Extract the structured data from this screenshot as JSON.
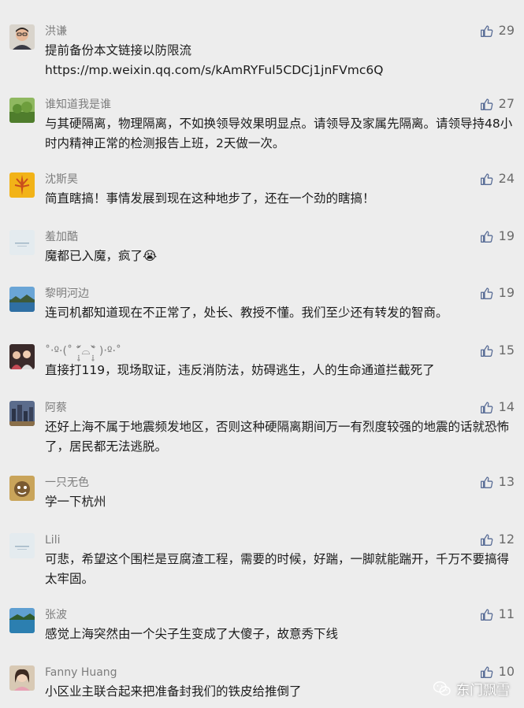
{
  "comments": [
    {
      "name": "洪谦",
      "lines": [
        "提前备份本文链接以防限流",
        "https://mp.weixin.qq.com/s/kAmRYFul5CDCj1jnFVmc6Q"
      ],
      "likes": "29",
      "avatar": "avatar-man-glasses"
    },
    {
      "name": "谁知道我是谁",
      "lines": [
        "与其硬隔离，物理隔离，不如换领导效果明显点。请领导及家属先隔离。请领导持48小时内精神正常的检测报告上班，2天做一次。"
      ],
      "likes": "27",
      "avatar": "avatar-green-field"
    },
    {
      "name": "沈斯昊",
      "lines": [
        "简直瞎搞！事情发展到现在这种地步了，还在一个劲的瞎搞！"
      ],
      "likes": "24",
      "avatar": "avatar-yellow-wheat"
    },
    {
      "name": "羞加酷",
      "lines": [
        "魔都已入魔，疯了😭"
      ],
      "likes": "19",
      "avatar": "avatar-light-text"
    },
    {
      "name": "黎明河边",
      "lines": [
        "连司机都知道现在不正常了，处长、教授不懂。我们至少还有转发的智商。"
      ],
      "likes": "19",
      "avatar": "avatar-blue-landscape"
    },
    {
      "name": "˚‧º·(˚ ˃̣̣̥᷄⌓˂̣̣̥᷅ )‧º·˚",
      "lines": [
        "直接打119，现场取证，违反消防法，妨碍逃生，人的生命通道拦截死了"
      ],
      "likes": "15",
      "avatar": "avatar-people"
    },
    {
      "name": "阿蔡",
      "lines": [
        "还好上海不属于地震频发地区，否则这种硬隔离期间万一有烈度较强的地震的话就恐怖了，居民都无法逃脱。"
      ],
      "likes": "14",
      "avatar": "avatar-city-night"
    },
    {
      "name": "一只无色",
      "lines": [
        "学一下杭州"
      ],
      "likes": "13",
      "avatar": "avatar-cartoon"
    },
    {
      "name": "Lili",
      "lines": [
        "可悲，希望这个围栏是豆腐渣工程，需要的时候，好踹，一脚就能踹开，千万不要搞得太牢固。"
      ],
      "likes": "12",
      "avatar": "avatar-light-text"
    },
    {
      "name": "张波",
      "lines": [
        "感觉上海突然由一个尖子生变成了大傻子，故意秀下线"
      ],
      "likes": "11",
      "avatar": "avatar-lake"
    },
    {
      "name": "Fanny Huang",
      "lines": [
        "小区业主联合起来把准备封我们的铁皮给推倒了"
      ],
      "likes": "10",
      "avatar": "avatar-girl"
    }
  ],
  "watermark": {
    "text": "东门飘雪",
    "icon": "wechat-icon"
  },
  "colors": {
    "background": "#ededed",
    "name": "#7d7d7d",
    "text": "#1b1b1b",
    "like": "#576b95"
  }
}
